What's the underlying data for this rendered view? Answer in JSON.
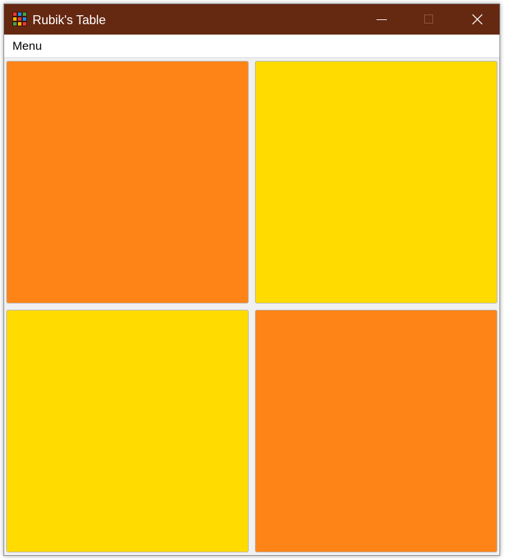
{
  "window": {
    "title": "Rubik's Table",
    "icon": "rubiks-cube-icon",
    "icon_colors": [
      "#e53935",
      "#1e88e5",
      "#43a047",
      "#ffb300",
      "#e53935",
      "#1e88e5",
      "#43a047",
      "#ffb300",
      "#e53935"
    ],
    "titlebar_color": "#652811",
    "controls": {
      "minimize": "minimize-icon",
      "maximize": "maximize-icon",
      "close": "close-icon"
    }
  },
  "menu": {
    "items": [
      {
        "label": "Menu"
      }
    ]
  },
  "grid": {
    "rows": 2,
    "cols": 2,
    "tiles": [
      {
        "color": "#ff8418"
      },
      {
        "color": "#ffdb00"
      },
      {
        "color": "#ffdb00"
      },
      {
        "color": "#ff8418"
      }
    ]
  }
}
